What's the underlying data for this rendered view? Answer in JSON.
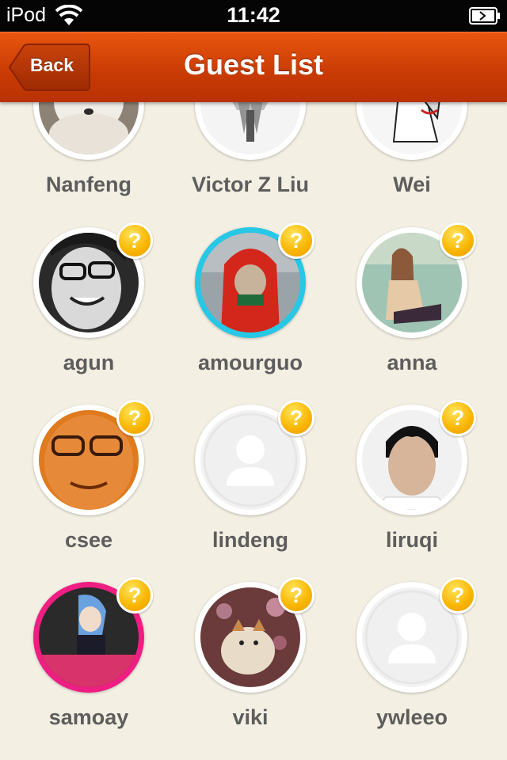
{
  "status_bar": {
    "carrier": "iPod",
    "time": "11:42",
    "icons": [
      "wifi-icon",
      "battery-icon"
    ]
  },
  "nav": {
    "back_label": "Back",
    "title": "Guest List"
  },
  "guests": [
    {
      "name": "Nanfeng",
      "badge": ""
    },
    {
      "name": "Victor Z Liu",
      "badge": ""
    },
    {
      "name": "Wei",
      "badge": ""
    },
    {
      "name": "agun",
      "badge": "?"
    },
    {
      "name": "amourguo",
      "badge": "?"
    },
    {
      "name": "anna",
      "badge": "?"
    },
    {
      "name": "csee",
      "badge": "?"
    },
    {
      "name": "lindeng",
      "badge": "?"
    },
    {
      "name": "liruqi",
      "badge": "?"
    },
    {
      "name": "samoay",
      "badge": "?"
    },
    {
      "name": "viki",
      "badge": "?"
    },
    {
      "name": "ywleeo",
      "badge": "?"
    }
  ],
  "colors": {
    "nav": "#c83a04",
    "background": "#f4efe3",
    "ring_blue": "#27c7e6",
    "ring_pink": "#ee1e82",
    "badge": "#f8b400"
  }
}
